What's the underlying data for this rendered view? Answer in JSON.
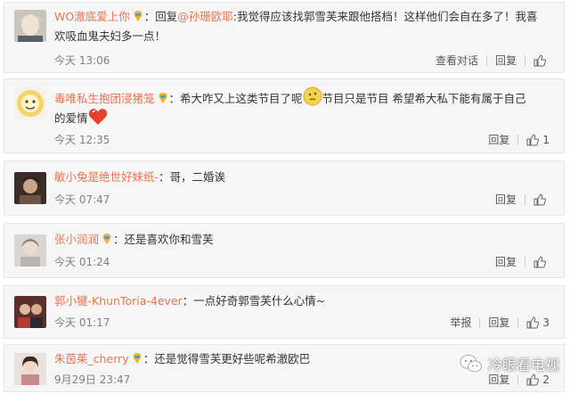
{
  "comments": [
    {
      "user": "WO澈底爱上你",
      "reply_label": "：回复",
      "reply_to": "@孙珊欧耶",
      "text_line1": ":我觉得应该找郭雪芙来跟他搭档！这样他们会自在多了！我喜",
      "text_line2": "欢吸血鬼夫妇多一点！",
      "time": "今天 13:06",
      "view_conversation": "查看对话",
      "reply": "回复",
      "likes": ""
    },
    {
      "user": "毒唯私生抱团浸猪笼",
      "text_before_emoji": "：希大咋又上这类节目了呢",
      "text_after_emoji": "节目只是节目   希望希大私下能有属于自己",
      "text_line2": "的爱情",
      "time": "今天 12:35",
      "reply": "回复",
      "likes": "1"
    },
    {
      "user": "敏小兔是绝世好妹纸-",
      "text": "：哥，二婚诶",
      "time": "今天 07:47",
      "reply": "回复",
      "likes": ""
    },
    {
      "user": "张小润润",
      "text": "：还是喜欢你和雪芙",
      "time": "今天 01:24",
      "reply": "回复",
      "likes": ""
    },
    {
      "user": "郭小犍-KhunToria-4ever",
      "text": "：一点好奇郭雪芙什么心情~",
      "time": "今天 01:17",
      "report": "举报",
      "reply": "回复",
      "likes": "3"
    },
    {
      "user": "朱茵茱_cherry",
      "text": "：还是觉得雪芙更好些呢希澈欧巴",
      "time": "9月29日 23:47",
      "reply": "回复",
      "likes": "2"
    }
  ],
  "watermark": {
    "text": "冷眼看电视",
    "icon": "wechat-icon"
  },
  "colors": {
    "username": "#eb7350",
    "card_bg": "#f6f6f6",
    "time": "#808080"
  }
}
